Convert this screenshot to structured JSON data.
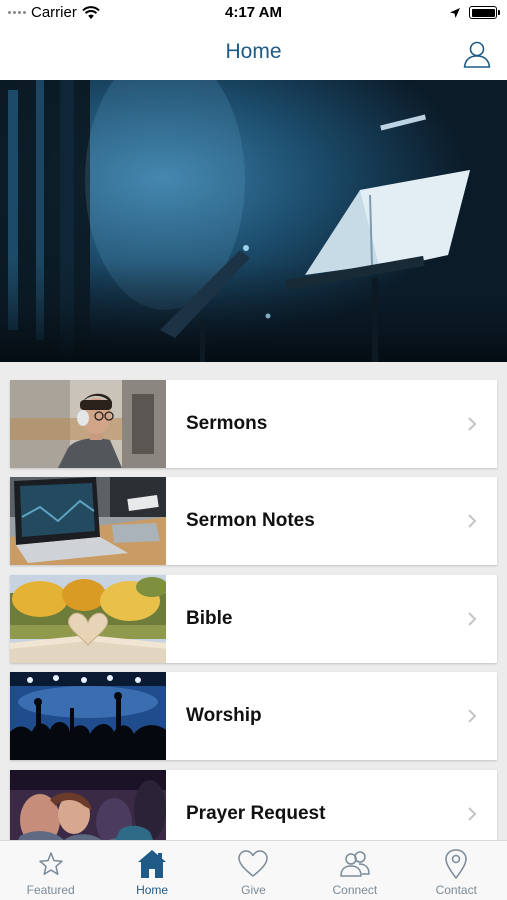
{
  "status_bar": {
    "carrier": "Carrier",
    "time": "4:17 AM"
  },
  "nav": {
    "title": "Home",
    "profile_icon": "person-icon"
  },
  "hero": {
    "image": "concert-stage-music-stand-photo"
  },
  "menu_items": [
    {
      "label": "Sermons",
      "thumbnail": "man-with-headphones-photo"
    },
    {
      "label": "Sermon Notes",
      "thumbnail": "laptop-on-desk-photo"
    },
    {
      "label": "Bible",
      "thumbnail": "open-bible-heart-pages-photo"
    },
    {
      "label": "Worship",
      "thumbnail": "worship-crowd-hands-raised-photo"
    },
    {
      "label": "Prayer Request",
      "thumbnail": "congregation-seated-photo"
    }
  ],
  "tabs": [
    {
      "label": "Featured",
      "icon": "star-icon",
      "active": false
    },
    {
      "label": "Home",
      "icon": "house-icon",
      "active": true
    },
    {
      "label": "Give",
      "icon": "heart-icon",
      "active": false
    },
    {
      "label": "Connect",
      "icon": "people-icon",
      "active": false
    },
    {
      "label": "Contact",
      "icon": "map-pin-icon",
      "active": false
    }
  ],
  "colors": {
    "accent": "#1f5b86",
    "inactive_tab": "#7a8a98",
    "list_background": "#ececec"
  }
}
